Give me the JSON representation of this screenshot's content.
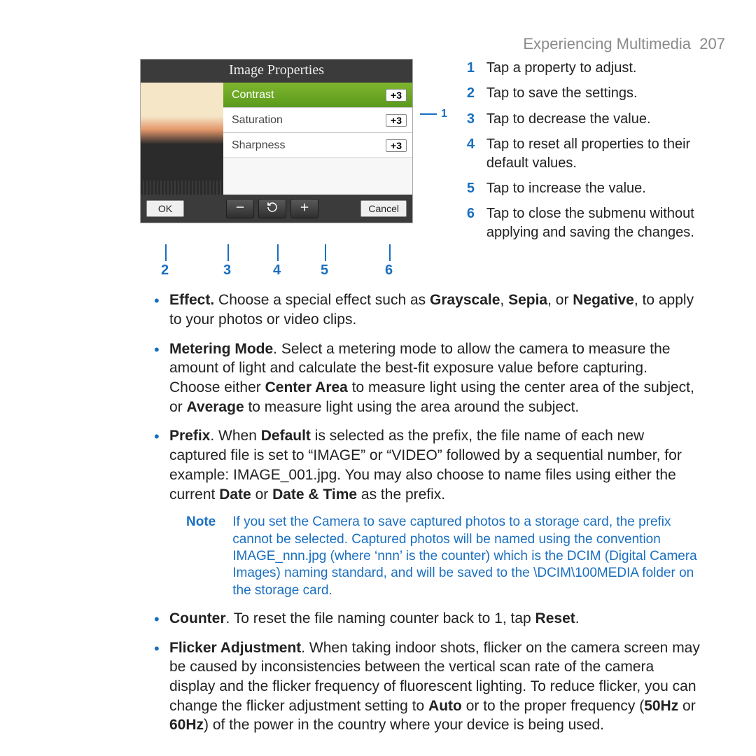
{
  "header": {
    "section": "Experiencing Multimedia",
    "page": "207"
  },
  "device": {
    "title": "Image Properties",
    "rows": [
      {
        "label": "Contrast",
        "value": "+3",
        "selected": true
      },
      {
        "label": "Saturation",
        "value": "+3",
        "selected": false
      },
      {
        "label": "Sharpness",
        "value": "+3",
        "selected": false
      }
    ],
    "ok": "OK",
    "cancel": "Cancel"
  },
  "callouts": {
    "side": "1",
    "bottom": [
      "2",
      "3",
      "4",
      "5",
      "6"
    ],
    "list": [
      "Tap a property to adjust.",
      "Tap to save the settings.",
      "Tap to decrease the value.",
      "Tap to reset all properties to their default values.",
      "Tap to increase the value.",
      "Tap to close the submenu without applying and saving the changes."
    ]
  },
  "bullets": {
    "effect_label": "Effect.",
    "effect_text_a": " Choose a special effect such as ",
    "effect_gray": "Grayscale",
    "effect_sep": ", ",
    "effect_sepia": "Sepia",
    "effect_or": ", or ",
    "effect_neg": "Negative",
    "effect_text_b": ", to apply to your photos or video clips.",
    "meter_label": "Metering Mode",
    "meter_a": ". Select a metering mode to allow the camera to measure the amount of light and calculate the best-fit exposure value before capturing. Choose either ",
    "meter_center": "Center Area",
    "meter_b": " to measure light using the center area of the subject, or ",
    "meter_avg": "Average",
    "meter_c": " to measure light using the area around the subject.",
    "prefix_label": "Prefix",
    "prefix_a": ". When ",
    "prefix_def": "Default",
    "prefix_b": " is selected as the prefix, the file name of each new captured file is set to “IMAGE” or “VIDEO” followed by a sequential number, for example: IMAGE_001.jpg. You may also choose to name files using either the current ",
    "prefix_date": "Date",
    "prefix_or": " or ",
    "prefix_dt": "Date & Time",
    "prefix_c": " as the prefix.",
    "counter_label": "Counter",
    "counter_a": ". To reset the file naming counter back to 1, tap ",
    "counter_reset": "Reset",
    "counter_b": ".",
    "flicker_label": "Flicker Adjustment",
    "flicker_a": ". When taking indoor shots, flicker on the camera screen may be caused by inconsistencies between the vertical scan rate of the camera display and the flicker frequency of fluorescent lighting. To reduce flicker, you can change the flicker adjustment setting to ",
    "flicker_auto": "Auto",
    "flicker_b": " or to the proper frequency (",
    "flicker_50": "50Hz",
    "flicker_or": " or ",
    "flicker_60": "60Hz",
    "flicker_c": ") of the power in the country where your device is being used."
  },
  "note": {
    "label": "Note",
    "text": "If you set the Camera to save captured photos to a storage card, the prefix cannot be selected. Captured photos will be named using the convention IMAGE_nnn.jpg (where ‘nnn’ is the counter) which is the DCIM (Digital Camera Images) naming standard, and will be saved to the \\DCIM\\100MEDIA folder on the storage card."
  }
}
